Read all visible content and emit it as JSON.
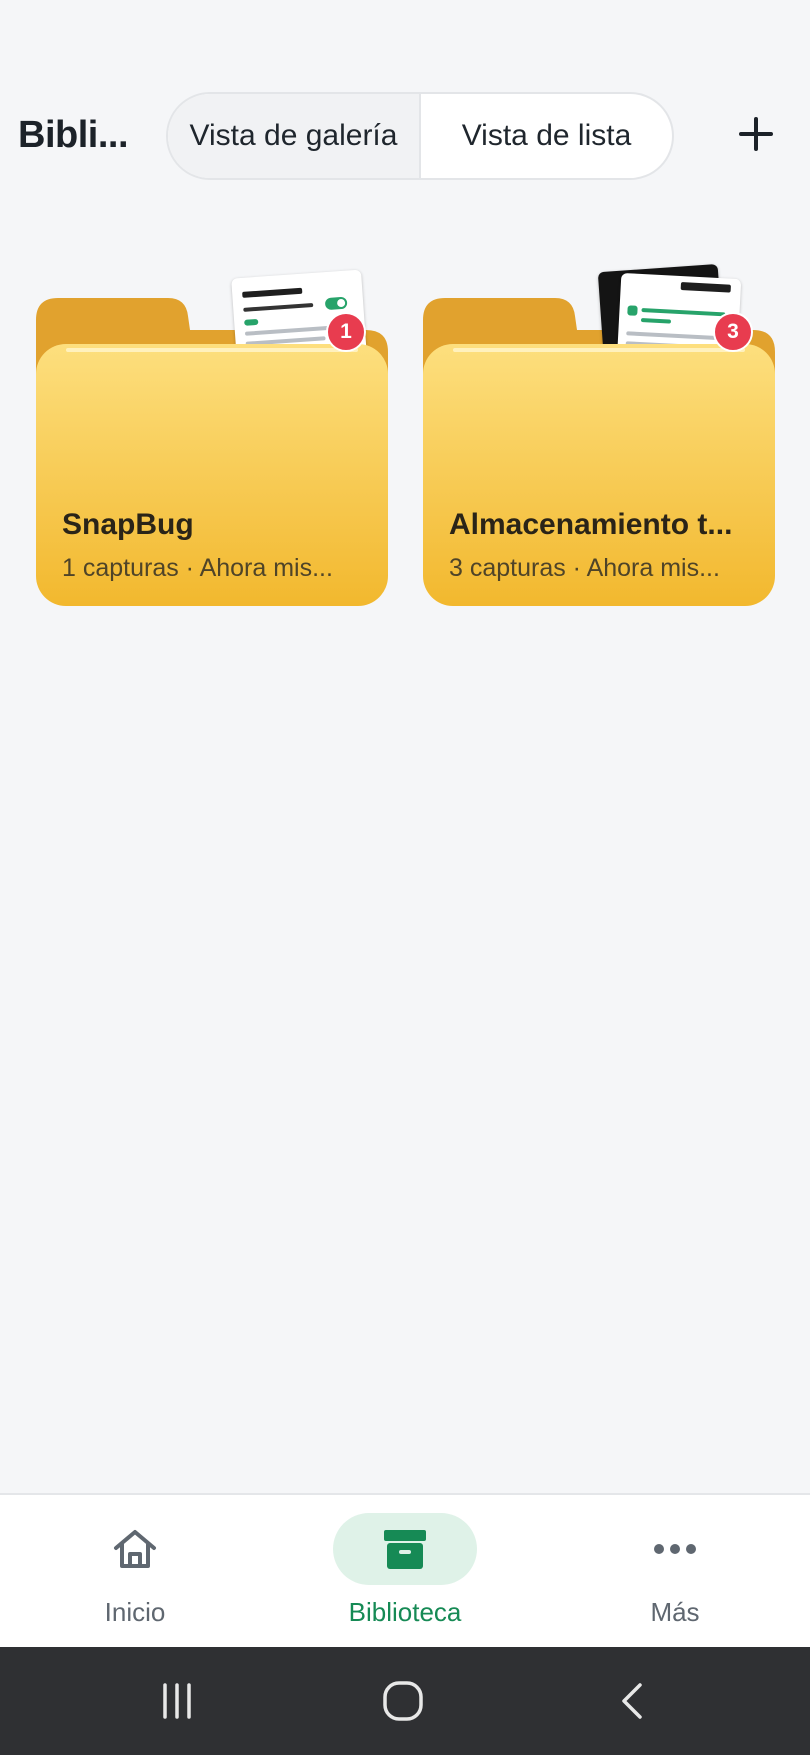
{
  "header": {
    "title": "Bibli...",
    "view_gallery_label": "Vista de galería",
    "view_list_label": "Vista de lista",
    "add_icon": "plus-icon"
  },
  "folders": [
    {
      "name": "SnapBug",
      "meta": "1 capturas · Ahora mis...",
      "badge": "1"
    },
    {
      "name": "Almacenamiento t...",
      "meta": "3 capturas · Ahora mis...",
      "badge": "3"
    }
  ],
  "bottom_nav": {
    "items": [
      {
        "label": "Inicio",
        "icon": "home-icon",
        "active": false
      },
      {
        "label": "Biblioteca",
        "icon": "archive-box-icon",
        "active": true
      },
      {
        "label": "Más",
        "icon": "more-dots-icon",
        "active": false
      }
    ]
  },
  "system_nav": {
    "recents_icon": "recents-icon",
    "home_icon": "home-circle-icon",
    "back_icon": "back-chevron-icon"
  },
  "colors": {
    "folder_back": "#e1a22e",
    "folder_front_top": "#fddf7e",
    "folder_front_bottom": "#f2b82e",
    "badge": "#e83c4f",
    "accent": "#168a55",
    "accent_bg": "#dff2e8"
  }
}
